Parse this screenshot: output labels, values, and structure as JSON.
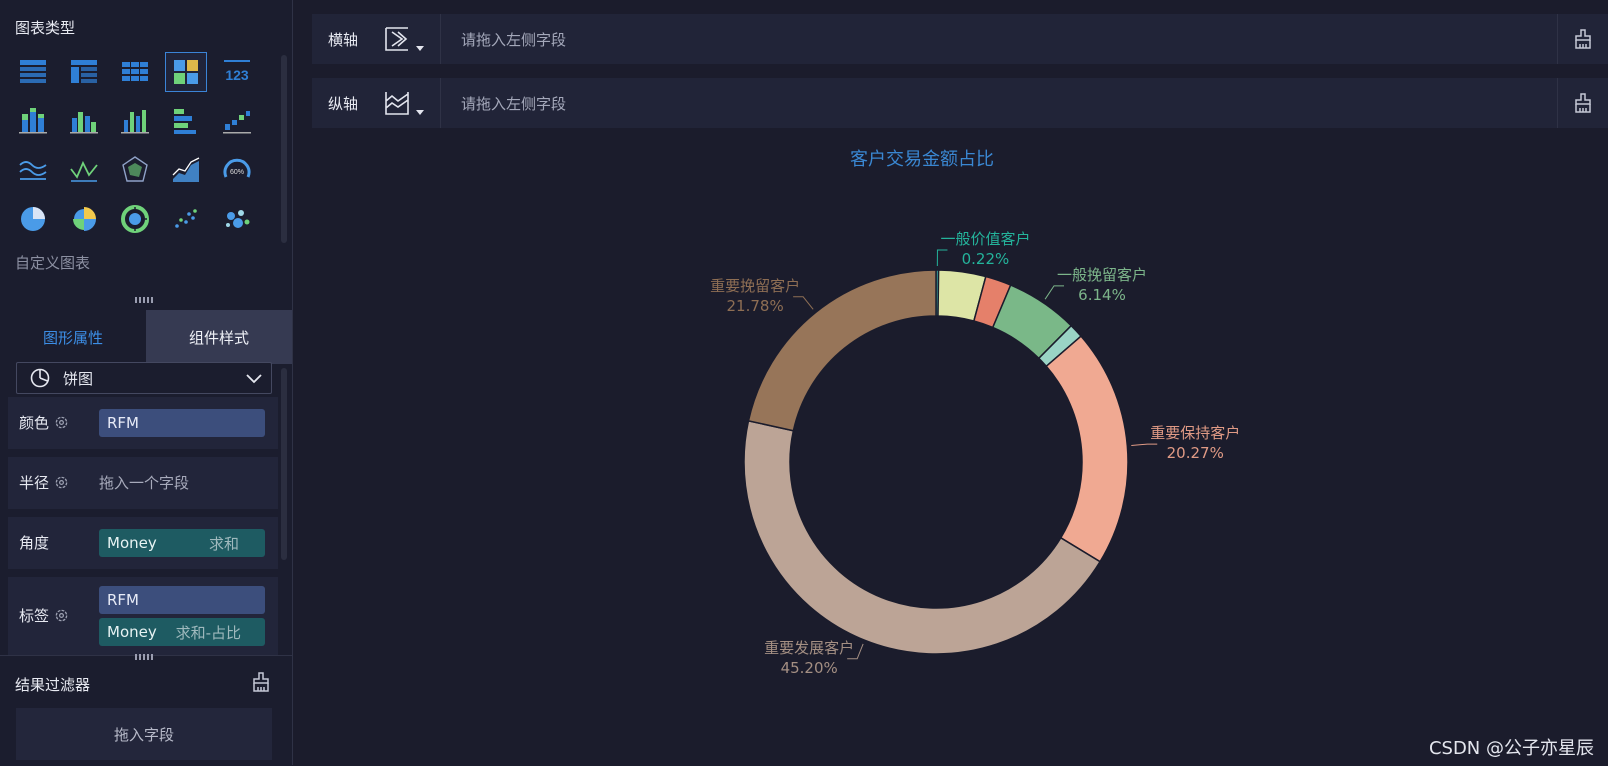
{
  "left_panel": {
    "chart_type_title": "图表类型",
    "chart_types": [
      "table-icon",
      "pivot-table-icon",
      "grid-table-icon",
      "heatmap-table-icon",
      "kpi-number-icon",
      "stacked-bar-icon",
      "grouped-bar-icon",
      "bar-chart-icon",
      "horizontal-bar-icon",
      "waterfall-icon",
      "multi-line-icon",
      "line-chart-icon",
      "radar-icon",
      "area-chart-icon",
      "gauge-icon",
      "pie-icon",
      "rose-pie-icon",
      "sunburst-icon",
      "scatter-icon",
      "bubble-icon"
    ],
    "kpi_text": "123",
    "gauge_text": "60%",
    "custom_chart_label": "自定义图表",
    "tabs": [
      "图形属性",
      "组件样式"
    ],
    "chart_select": "饼图",
    "properties": [
      {
        "label": "颜色",
        "chips": [
          {
            "text": "RFM"
          }
        ]
      },
      {
        "label": "半径",
        "placeholder": "拖入一个字段"
      },
      {
        "label": "角度",
        "chips": [
          {
            "text": "Money",
            "agg": "求和"
          }
        ]
      },
      {
        "label": "标签",
        "chips": [
          {
            "text": "RFM"
          },
          {
            "text": "Money",
            "agg": "求和-占比"
          }
        ]
      }
    ],
    "filter": {
      "title": "结果过滤器",
      "drop": "拖入字段"
    }
  },
  "axes": {
    "x": {
      "name": "横轴",
      "placeholder": "请拖入左侧字段"
    },
    "y": {
      "name": "纵轴",
      "placeholder": "请拖入左侧字段"
    }
  },
  "colors": {
    "accent": "#3c8ee6",
    "title": "#3a87d2"
  },
  "watermark": "CSDN @公子亦星辰",
  "chart_data": {
    "type": "pie",
    "title": "客户交易金额占比",
    "donut": true,
    "slices": [
      {
        "name": "一般价值客户",
        "value": 0.22,
        "label": "0.22%",
        "color": "#3bb7b0",
        "label_color": "#24b39b",
        "show_label": true
      },
      {
        "name": "",
        "value": 4.0,
        "color": "#dde5a6",
        "show_label": false
      },
      {
        "name": "",
        "value": 2.2,
        "color": "#e5806a",
        "show_label": false
      },
      {
        "name": "一般挽留客户",
        "value": 6.14,
        "label": "6.14%",
        "color": "#7ab888",
        "label_color": "#7cb58a",
        "show_label": true
      },
      {
        "name": "",
        "value": 1.2,
        "color": "#9ad4c5",
        "show_label": false
      },
      {
        "name": "重要保持客户",
        "value": 20.27,
        "label": "20.27%",
        "color": "#f0a992",
        "label_color": "#e09a85",
        "show_label": true
      },
      {
        "name": "重要发展客户",
        "value": 45.2,
        "label": "45.20%",
        "color": "#bca496",
        "label_color": "#a48f83",
        "show_label": true
      },
      {
        "name": "重要挽留客户",
        "value": 21.78,
        "label": "21.78%",
        "color": "#977559",
        "label_color": "#8e6e54",
        "show_label": true
      }
    ]
  }
}
